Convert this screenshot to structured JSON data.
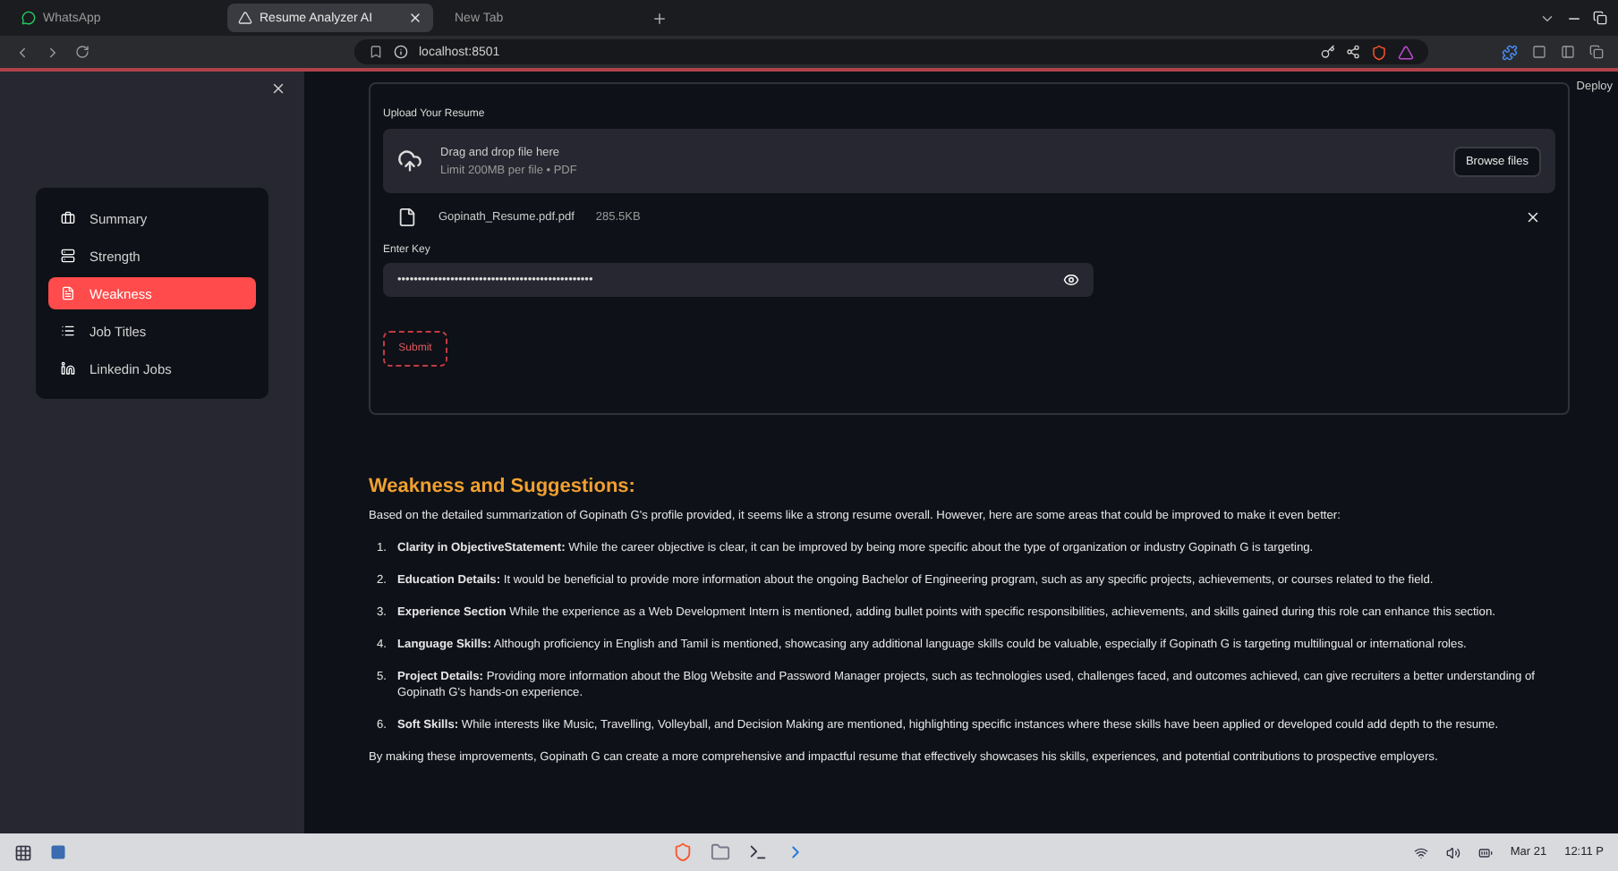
{
  "browser": {
    "tabs": [
      {
        "title": "WhatsApp",
        "selected": false
      },
      {
        "title": "Resume Analyzer AI",
        "selected": true
      },
      {
        "title": "New Tab",
        "selected": false
      }
    ],
    "address": "localhost:8501"
  },
  "sidebar": {
    "items": [
      {
        "label": "Summary",
        "selected": false
      },
      {
        "label": "Strength",
        "selected": false
      },
      {
        "label": "Weakness",
        "selected": true
      },
      {
        "label": "Job Titles",
        "selected": false
      },
      {
        "label": "Linkedin Jobs",
        "selected": false
      }
    ]
  },
  "deploy": "Deploy",
  "form": {
    "upload_label": "Upload Your Resume",
    "drop_title": "Drag and drop file here",
    "drop_hint": "Limit 200MB per file • PDF",
    "browse_button": "Browse files",
    "file": {
      "name": "Gopinath_Resume.pdf.pdf",
      "size": "285.5KB"
    },
    "key_label": "Enter Key",
    "key_value": "••••••••••••••••••••••••••••••••••••••••••••••••",
    "submit": "Submit"
  },
  "result": {
    "heading": "Weakness and Suggestions:",
    "intro": "Based on the detailed summarization of Gopinath G's profile provided, it seems like a strong resume overall. However, here are some areas that could be improved to make it even better:",
    "items": [
      {
        "number": "1.",
        "text": "**Clarity in ObjectiveStatement:** While the career objective is clear, it can be improved by being more specific about the type of organization or industry Gopinath G is targeting."
      },
      {
        "number": "2.",
        "text": "**Education Details:** It would be beneficial to provide more information about the ongoing Bachelor of Engineering program, such as any specific projects, achievements, or courses related to the field."
      },
      {
        "number": "3.",
        "text": "**Experience Section** While the experience as a Web Development Intern is mentioned, adding bullet points with specific responsibilities, achievements, and skills gained during this role can enhance this section."
      },
      {
        "number": "4.",
        "text": "**Language Skills:** Although proficiency in English and Tamil is mentioned, showcasing any additional language skills could be valuable, especially if Gopinath G is targeting multilingual or international roles."
      },
      {
        "number": "5.",
        "text": "**Project Details:** Providing more information about the Blog Website and Password Manager projects, such as technologies used, challenges faced, and outcomes achieved, can give recruiters a better understanding of Gopinath G's hands-on experience."
      },
      {
        "number": "6.",
        "text": "**Soft Skills:** While interests like Music, Travelling, Volleyball, and Decision Making are mentioned, highlighting specific instances where these skills have been applied or developed could add depth to the resume."
      }
    ],
    "outro": "By making these improvements, Gopinath G can create a more comprehensive and impactful resume that effectively showcases his skills, experiences, and potential contributions to prospective employers."
  },
  "taskbar": {
    "date": "Mar 21",
    "time": "12:11 P"
  }
}
